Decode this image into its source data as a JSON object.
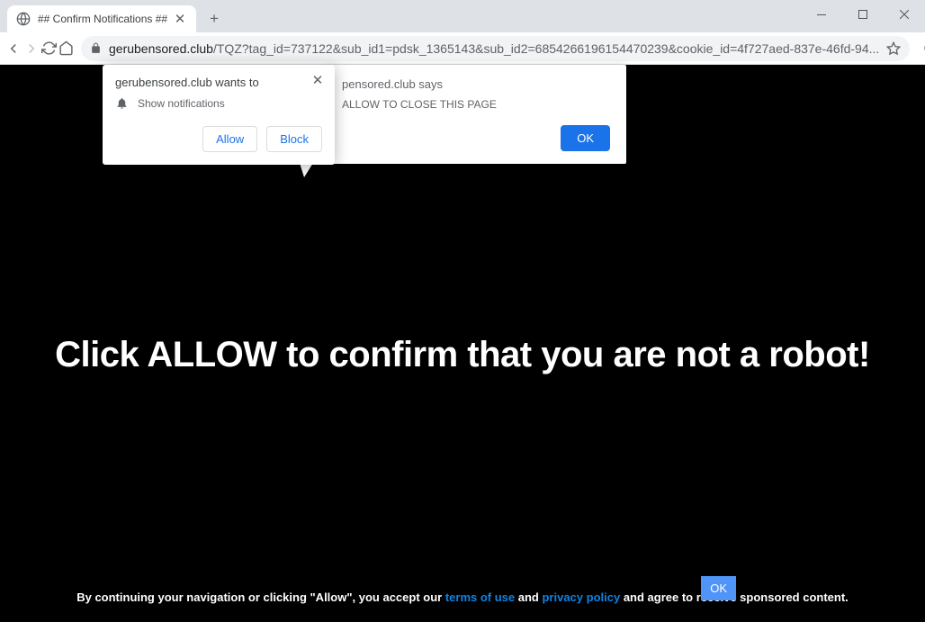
{
  "tab": {
    "title": "## Confirm Notifications ##"
  },
  "url": {
    "domain": "gerubensored.club",
    "path": "/TQZ?tag_id=737122&sub_id1=pdsk_1365143&sub_id2=6854266196154470239&cookie_id=4f727aed-837e-46fd-94..."
  },
  "notification": {
    "title": "gerubensored.club wants to",
    "permission_label": "Show notifications",
    "allow": "Allow",
    "block": "Block"
  },
  "js_dialog": {
    "title_suffix": "pensored.club says",
    "message_suffix": "ALLOW TO CLOSE THIS PAGE",
    "ok": "OK"
  },
  "page": {
    "headline": "Click ALLOW to confirm that you are not a robot!"
  },
  "footer": {
    "pre": "By continuing your navigation or clicking \"Allow\", you accept our ",
    "terms": "terms of use",
    "and": " and ",
    "privacy": "privacy policy",
    "post": " and agree to receive sponsored content.",
    "ok": "OK"
  }
}
